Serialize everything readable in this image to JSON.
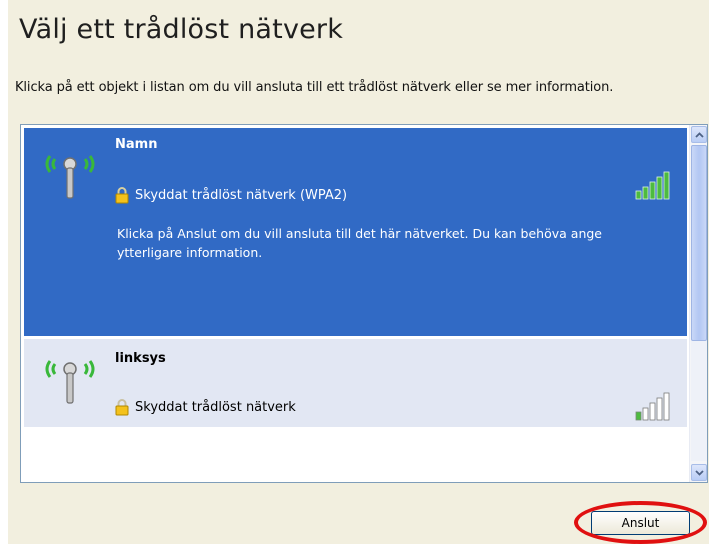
{
  "title": "Välj ett trådlöst nätverk",
  "instruction": "Klicka på ett objekt i listan om du vill ansluta till ett trådlöst nätverk eller se mer information.",
  "networks": [
    {
      "name": "Namn",
      "security": "Skyddat trådlöst nätverk (WPA2)",
      "description": "Klicka på Anslut om du vill ansluta till det här nätverket. Du kan behöva ange ytterligare information.",
      "selected": true,
      "signal_bars": 5
    },
    {
      "name": "linksys",
      "security": "Skyddat trådlöst nätverk",
      "selected": false,
      "signal_bars": 1
    }
  ],
  "connect_label": "Anslut",
  "colors": {
    "selection": "#316ac5",
    "item_bg": "#e2e7f3",
    "panel_bg": "#f2efdf",
    "signal_green": "#3aa03a",
    "highlight_ring": "#e01010"
  },
  "icons": {
    "network": "wireless-antenna-icon",
    "lock": "lock-icon",
    "signal": "signal-strength-icon",
    "scroll_up": "chevron-up-icon",
    "scroll_down": "chevron-down-icon"
  }
}
